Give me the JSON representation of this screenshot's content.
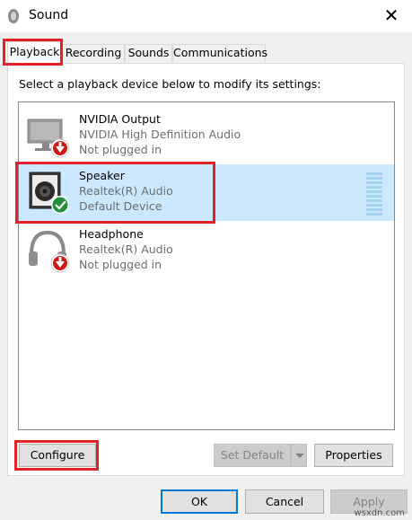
{
  "window": {
    "title": "Sound",
    "close_glyph": "✕"
  },
  "tabs": [
    {
      "label": "Playback",
      "active": true
    },
    {
      "label": "Recording"
    },
    {
      "label": "Sounds"
    },
    {
      "label": "Communications"
    }
  ],
  "instruction": "Select a playback device below to modify its settings:",
  "devices": [
    {
      "name": "NVIDIA Output",
      "driver": "NVIDIA High Definition Audio",
      "status": "Not plugged in",
      "icon": "monitor-icon",
      "badge": "unplugged-arrow-icon"
    },
    {
      "name": "Speaker",
      "driver": "Realtek(R) Audio",
      "status": "Default Device",
      "icon": "speaker-icon",
      "badge": "default-check-icon",
      "selected": true
    },
    {
      "name": "Headphone",
      "driver": "Realtek(R) Audio",
      "status": "Not plugged in",
      "icon": "headphone-icon",
      "badge": "unplugged-arrow-icon"
    }
  ],
  "buttons": {
    "configure": "Configure",
    "set_default": "Set Default",
    "properties": "Properties",
    "ok": "OK",
    "cancel": "Cancel",
    "apply": "Apply"
  },
  "colors": {
    "selection": "#cce8ff",
    "highlight_box": "#e32228",
    "accent": "#0078d7"
  },
  "watermark": "wsxdn.com"
}
